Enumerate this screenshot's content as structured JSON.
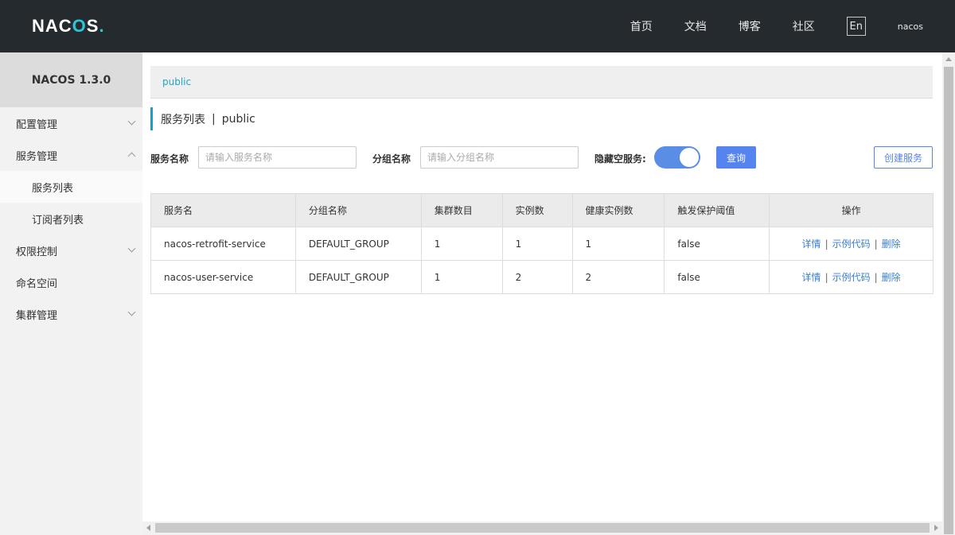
{
  "header": {
    "logo_text": "NACOS",
    "nav": [
      "首页",
      "文档",
      "博客",
      "社区"
    ],
    "lang": "En",
    "user": "nacos"
  },
  "sidebar": {
    "title": "NACOS 1.3.0",
    "items": [
      {
        "label": "配置管理",
        "chevron": "down"
      },
      {
        "label": "服务管理",
        "chevron": "up"
      },
      {
        "label": "服务列表",
        "sub": true,
        "active": true
      },
      {
        "label": "订阅者列表",
        "sub": true
      },
      {
        "label": "权限控制",
        "chevron": "down"
      },
      {
        "label": "命名空间"
      },
      {
        "label": "集群管理",
        "chevron": "down"
      }
    ]
  },
  "main": {
    "namespace": "public",
    "title": "服务列表",
    "title_sep": "|",
    "title_ns": "public",
    "filter": {
      "service_label": "服务名称",
      "service_placeholder": "请输入服务名称",
      "group_label": "分组名称",
      "group_placeholder": "请输入分组名称",
      "hide_empty_label": "隐藏空服务:",
      "hide_empty_on": true,
      "query_label": "查询",
      "create_label": "创建服务"
    },
    "table": {
      "headers": [
        "服务名",
        "分组名称",
        "集群数目",
        "实例数",
        "健康实例数",
        "触发保护阈值",
        "操作"
      ],
      "rows": [
        [
          "nacos-retrofit-service",
          "DEFAULT_GROUP",
          "1",
          "1",
          "1",
          "false"
        ],
        [
          "nacos-user-service",
          "DEFAULT_GROUP",
          "1",
          "2",
          "2",
          "false"
        ]
      ],
      "ops": {
        "detail": "详情",
        "sample": "示例代码",
        "delete": "删除",
        "sep": "|"
      }
    }
  },
  "colors": {
    "header_bg": "#252a2f",
    "accent": "#5584ef",
    "link": "#3a7fd5",
    "namespace": "#1ea4c8"
  }
}
